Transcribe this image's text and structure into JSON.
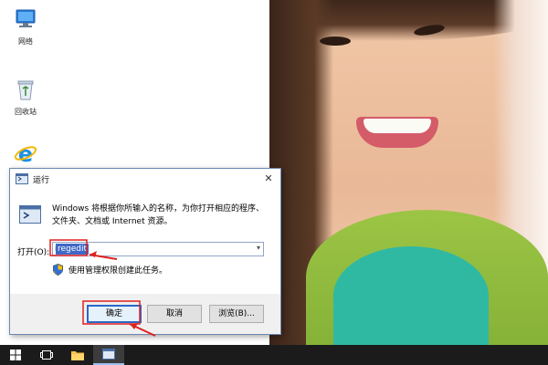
{
  "desktop": {
    "icons": [
      {
        "label": "网络",
        "icon": "network-icon"
      },
      {
        "label": "回收站",
        "icon": "recycle-bin-icon"
      },
      {
        "label": "",
        "icon": "internet-explorer-icon"
      }
    ]
  },
  "run_dialog": {
    "title": "运行",
    "description": "Windows 将根据你所输入的名称，为你打开相应的程序、文件夹、文档或 Internet 资源。",
    "open_label": "打开(O):",
    "open_value": "regedit",
    "admin_note": "使用管理权限创建此任务。",
    "buttons": {
      "ok": "确定",
      "cancel": "取消",
      "browse": "浏览(B)..."
    }
  },
  "taskbar": {
    "items": [
      "start-icon",
      "task-view-icon",
      "file-explorer-icon",
      "run-app-icon"
    ]
  },
  "colors": {
    "selection": "#3f68c7",
    "annotation": "#e02020",
    "taskbar": "#1b1b1b"
  }
}
